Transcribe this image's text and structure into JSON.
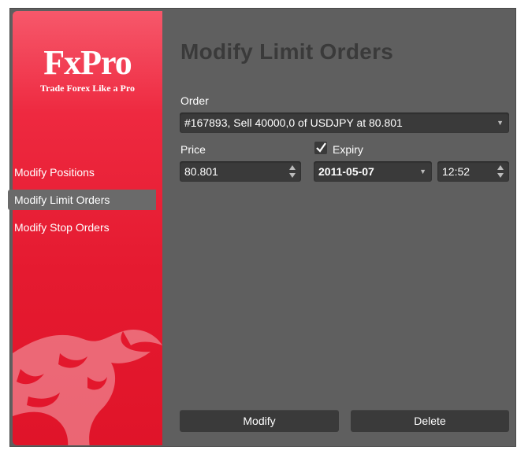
{
  "brand": {
    "logo_text": "FxPro",
    "tagline": "Trade Forex Like a Pro"
  },
  "sidebar": {
    "items": [
      {
        "label": "Modify Positions",
        "active": false
      },
      {
        "label": "Modify Limit Orders",
        "active": true
      },
      {
        "label": "Modify Stop Orders",
        "active": false
      }
    ]
  },
  "main": {
    "title": "Modify Limit Orders",
    "order": {
      "label": "Order",
      "value": "#167893, Sell 40000,0 of USDJPY at 80.801"
    },
    "price": {
      "label": "Price",
      "value": "80.801"
    },
    "expiry": {
      "label": "Expiry",
      "checked": true,
      "date": "2011-05-07",
      "time": "12:52"
    },
    "buttons": {
      "modify": "Modify",
      "delete": "Delete"
    }
  },
  "colors": {
    "sidebar_red": "#e51a30",
    "panel_bg": "#5f5f5f",
    "field_bg": "#3a3a3a",
    "active_nav_bg": "#6a6a6a"
  }
}
